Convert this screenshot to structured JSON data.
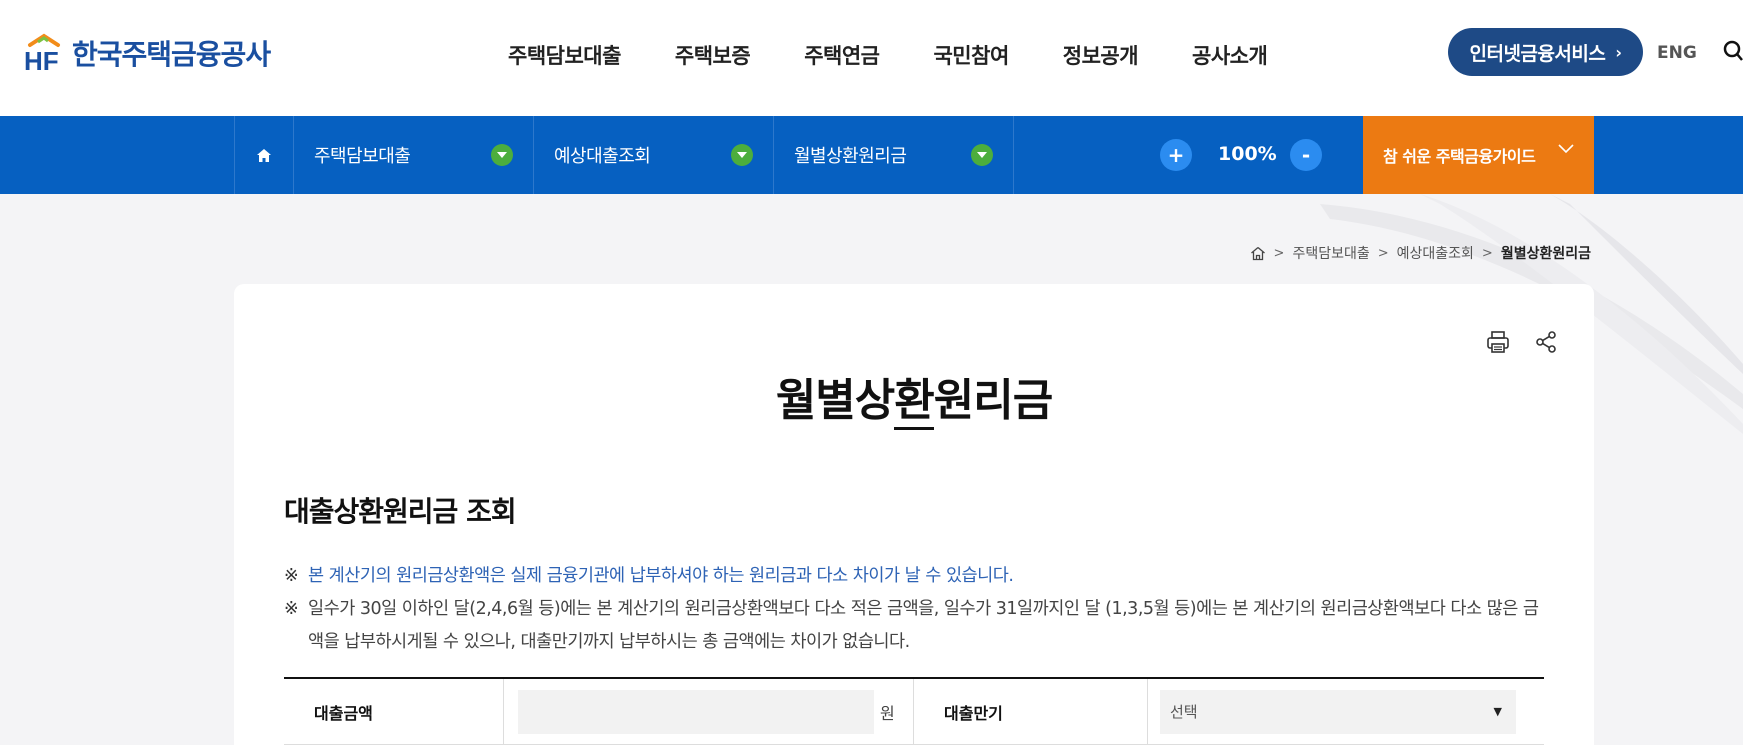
{
  "header": {
    "logo_mark": "HF",
    "logo_name": "한국주택금융공사",
    "gnb": [
      "주택담보대출",
      "주택보증",
      "주택연금",
      "국민참여",
      "정보공개",
      "공사소개"
    ],
    "internet_service": "인터넷금융서비스",
    "eng": "ENG",
    "icons": {
      "search": "search-icon",
      "chevron": "chevron-right-icon"
    }
  },
  "navbar": {
    "home_icon": "home-icon",
    "segments": [
      "주택담보대출",
      "예상대출조회",
      "월별상환원리금"
    ],
    "zoom_in": "+",
    "zoom_level": "100%",
    "zoom_out": "-",
    "guide": "참 쉬운 주택금융가이드",
    "colors": {
      "bar": "#0660c1",
      "dropdown": "#4cae3d",
      "zoom": "#2b8cf0",
      "guide": "#ec7a12"
    }
  },
  "breadcrumb": [
    "주택담보대출",
    "예상대출조회",
    "월별상환원리금"
  ],
  "content": {
    "page_title": "월별상환원리금",
    "section_title": "대출상환원리금 조회",
    "notes": [
      {
        "mark": "※",
        "text": "본 계산기의 원리금상환액은 실제 금융기관에 납부하셔야 하는 원리금과 다소 차이가 날 수 있습니다."
      },
      {
        "mark": "※",
        "text": "일수가 30일 이하인 달(2,4,6월 등)에는 본 계산기의 원리금상환액보다 다소 적은 금액을, 일수가 31일까지인 달 (1,3,5월 등)에는 본 계산기의 원리금상환액보다 다소 많은 금액을 납부하시게될 수 있으나, 대출만기까지 납부하시는 총 금액에는 차이가 없습니다."
      }
    ],
    "form": {
      "loan_amount_label": "대출금액",
      "loan_amount_value": "",
      "loan_amount_unit": "원",
      "maturity_label": "대출만기",
      "maturity_selected": "선택"
    }
  }
}
